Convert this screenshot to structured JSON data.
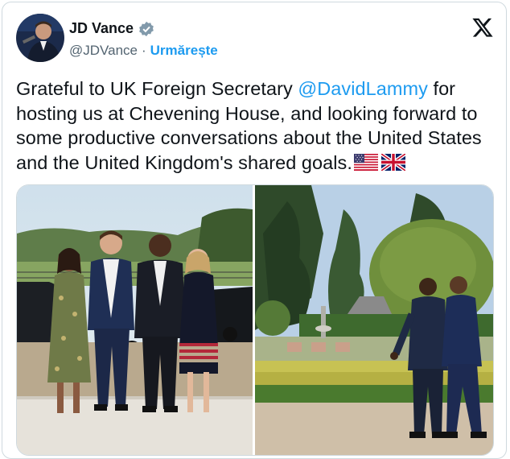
{
  "author": {
    "name": "JD Vance",
    "handle": "@JDVance",
    "separator": "·",
    "follow_label": "Urmărește",
    "verified_icon": "verified-badge-icon",
    "avatar_icon": "profile-photo"
  },
  "platform_icon": "x-logo-icon",
  "tweet": {
    "text_before": "Grateful to UK Foreign Secretary ",
    "mention": "@DavidLammy",
    "text_after": " for hosting us at Chevening House, and looking forward to some productive conversations about the United States and the United Kingdom's shared goals.",
    "flags": [
      "us-flag-emoji",
      "uk-flag-emoji"
    ]
  },
  "media": [
    {
      "id": "photo-group-portrait",
      "kind": "photo"
    },
    {
      "id": "photo-garden-walk",
      "kind": "photo"
    }
  ],
  "colors": {
    "link": "#1d9bf0",
    "text": "#0f1419",
    "muted": "#536471",
    "border": "#cfd9de"
  }
}
